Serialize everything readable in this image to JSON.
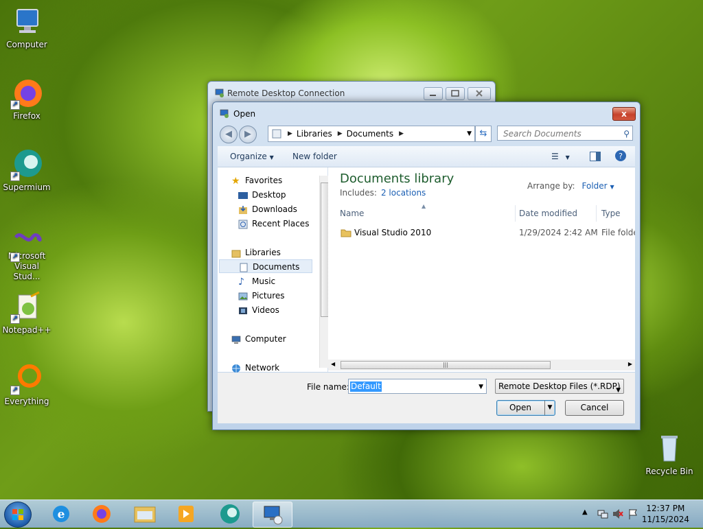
{
  "desktop": {
    "icons": [
      {
        "label": "Computer",
        "icon": "computer-icon"
      },
      {
        "label": "Firefox",
        "icon": "firefox-icon"
      },
      {
        "label": "Supermium",
        "icon": "supermium-icon"
      },
      {
        "label": "Microsoft Visual Stud...",
        "icon": "visual-studio-icon"
      },
      {
        "label": "Notepad++",
        "icon": "notepadpp-icon"
      },
      {
        "label": "Everything",
        "icon": "everything-icon"
      }
    ],
    "recycle_bin": "Recycle Bin"
  },
  "rdc_window": {
    "title": "Remote Desktop Connection"
  },
  "dialog": {
    "title": "Open",
    "close_label": "x",
    "address": {
      "segments": [
        "Libraries",
        "Documents"
      ]
    },
    "search_placeholder": "Search Documents",
    "toolbar": {
      "organize": "Organize",
      "new_folder": "New folder"
    },
    "nav": {
      "favorites": "Favorites",
      "desktop": "Desktop",
      "downloads": "Downloads",
      "recent": "Recent Places",
      "libraries": "Libraries",
      "documents": "Documents",
      "music": "Music",
      "pictures": "Pictures",
      "videos": "Videos",
      "computer": "Computer",
      "network": "Network"
    },
    "content": {
      "library_title": "Documents library",
      "includes_label": "Includes:",
      "locations_link": "2 locations",
      "arrange_by_label": "Arrange by:",
      "arrange_by_value": "Folder",
      "columns": {
        "name": "Name",
        "date": "Date modified",
        "type": "Type"
      },
      "rows": [
        {
          "name": "Visual Studio 2010",
          "date": "1/29/2024 2:42 AM",
          "type": "File folder"
        }
      ]
    },
    "file_name_label": "File name:",
    "file_name_value": "Default",
    "file_type_value": "Remote Desktop Files (*.RDP)",
    "open_button": "Open",
    "cancel_button": "Cancel"
  },
  "taskbar": {
    "time": "12:37 PM",
    "date": "11/15/2024"
  }
}
